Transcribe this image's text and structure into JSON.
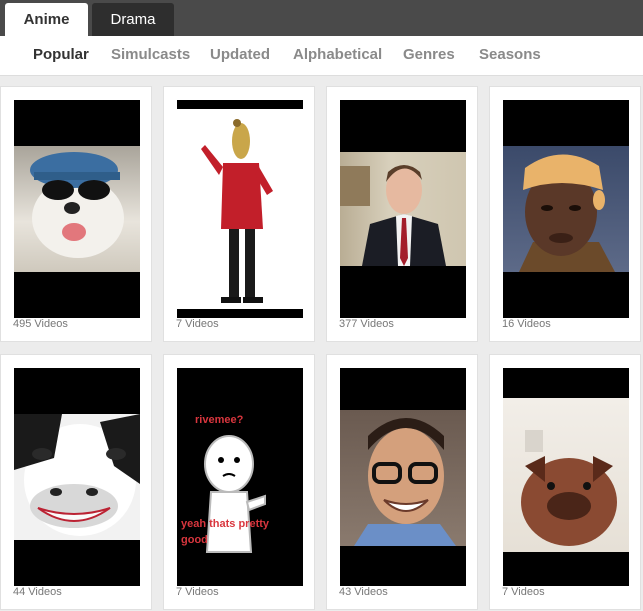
{
  "tabs": [
    {
      "label": "Anime",
      "active": true
    },
    {
      "label": "Drama",
      "active": false
    }
  ],
  "subnav": [
    {
      "label": "Popular",
      "selected": true
    },
    {
      "label": "Simulcasts",
      "selected": false
    },
    {
      "label": "Updated",
      "selected": false
    },
    {
      "label": "Alphabetical",
      "selected": false
    },
    {
      "label": "Genres",
      "selected": false
    },
    {
      "label": "Seasons",
      "selected": false
    }
  ],
  "cards": [
    {
      "count": "495 Videos",
      "subject": "dog wearing blue cap and sunglasses"
    },
    {
      "count": "7 Videos",
      "subject": "dancing figure in red jacket"
    },
    {
      "count": "377 Videos",
      "subject": "person in suit and red tie"
    },
    {
      "count": "16 Videos",
      "subject": "man with pancake on head"
    },
    {
      "count": "44 Videos",
      "subject": "smiling cow"
    },
    {
      "count": "7 Videos",
      "subject": "meme drawing",
      "texts": [
        "rivemee?",
        "yeah thats pretty",
        "good"
      ]
    },
    {
      "count": "43 Videos",
      "subject": "smiling man with glasses"
    },
    {
      "count": "7 Videos",
      "subject": "dog close-up"
    }
  ],
  "colors": {
    "topbar": "#4a4a4a",
    "active_tab": "#ffffff",
    "inactive_tab": "#2e2e2e",
    "subnav_selected": "#333333",
    "subnav_default": "#8a8a8a",
    "count_text": "#777777"
  }
}
